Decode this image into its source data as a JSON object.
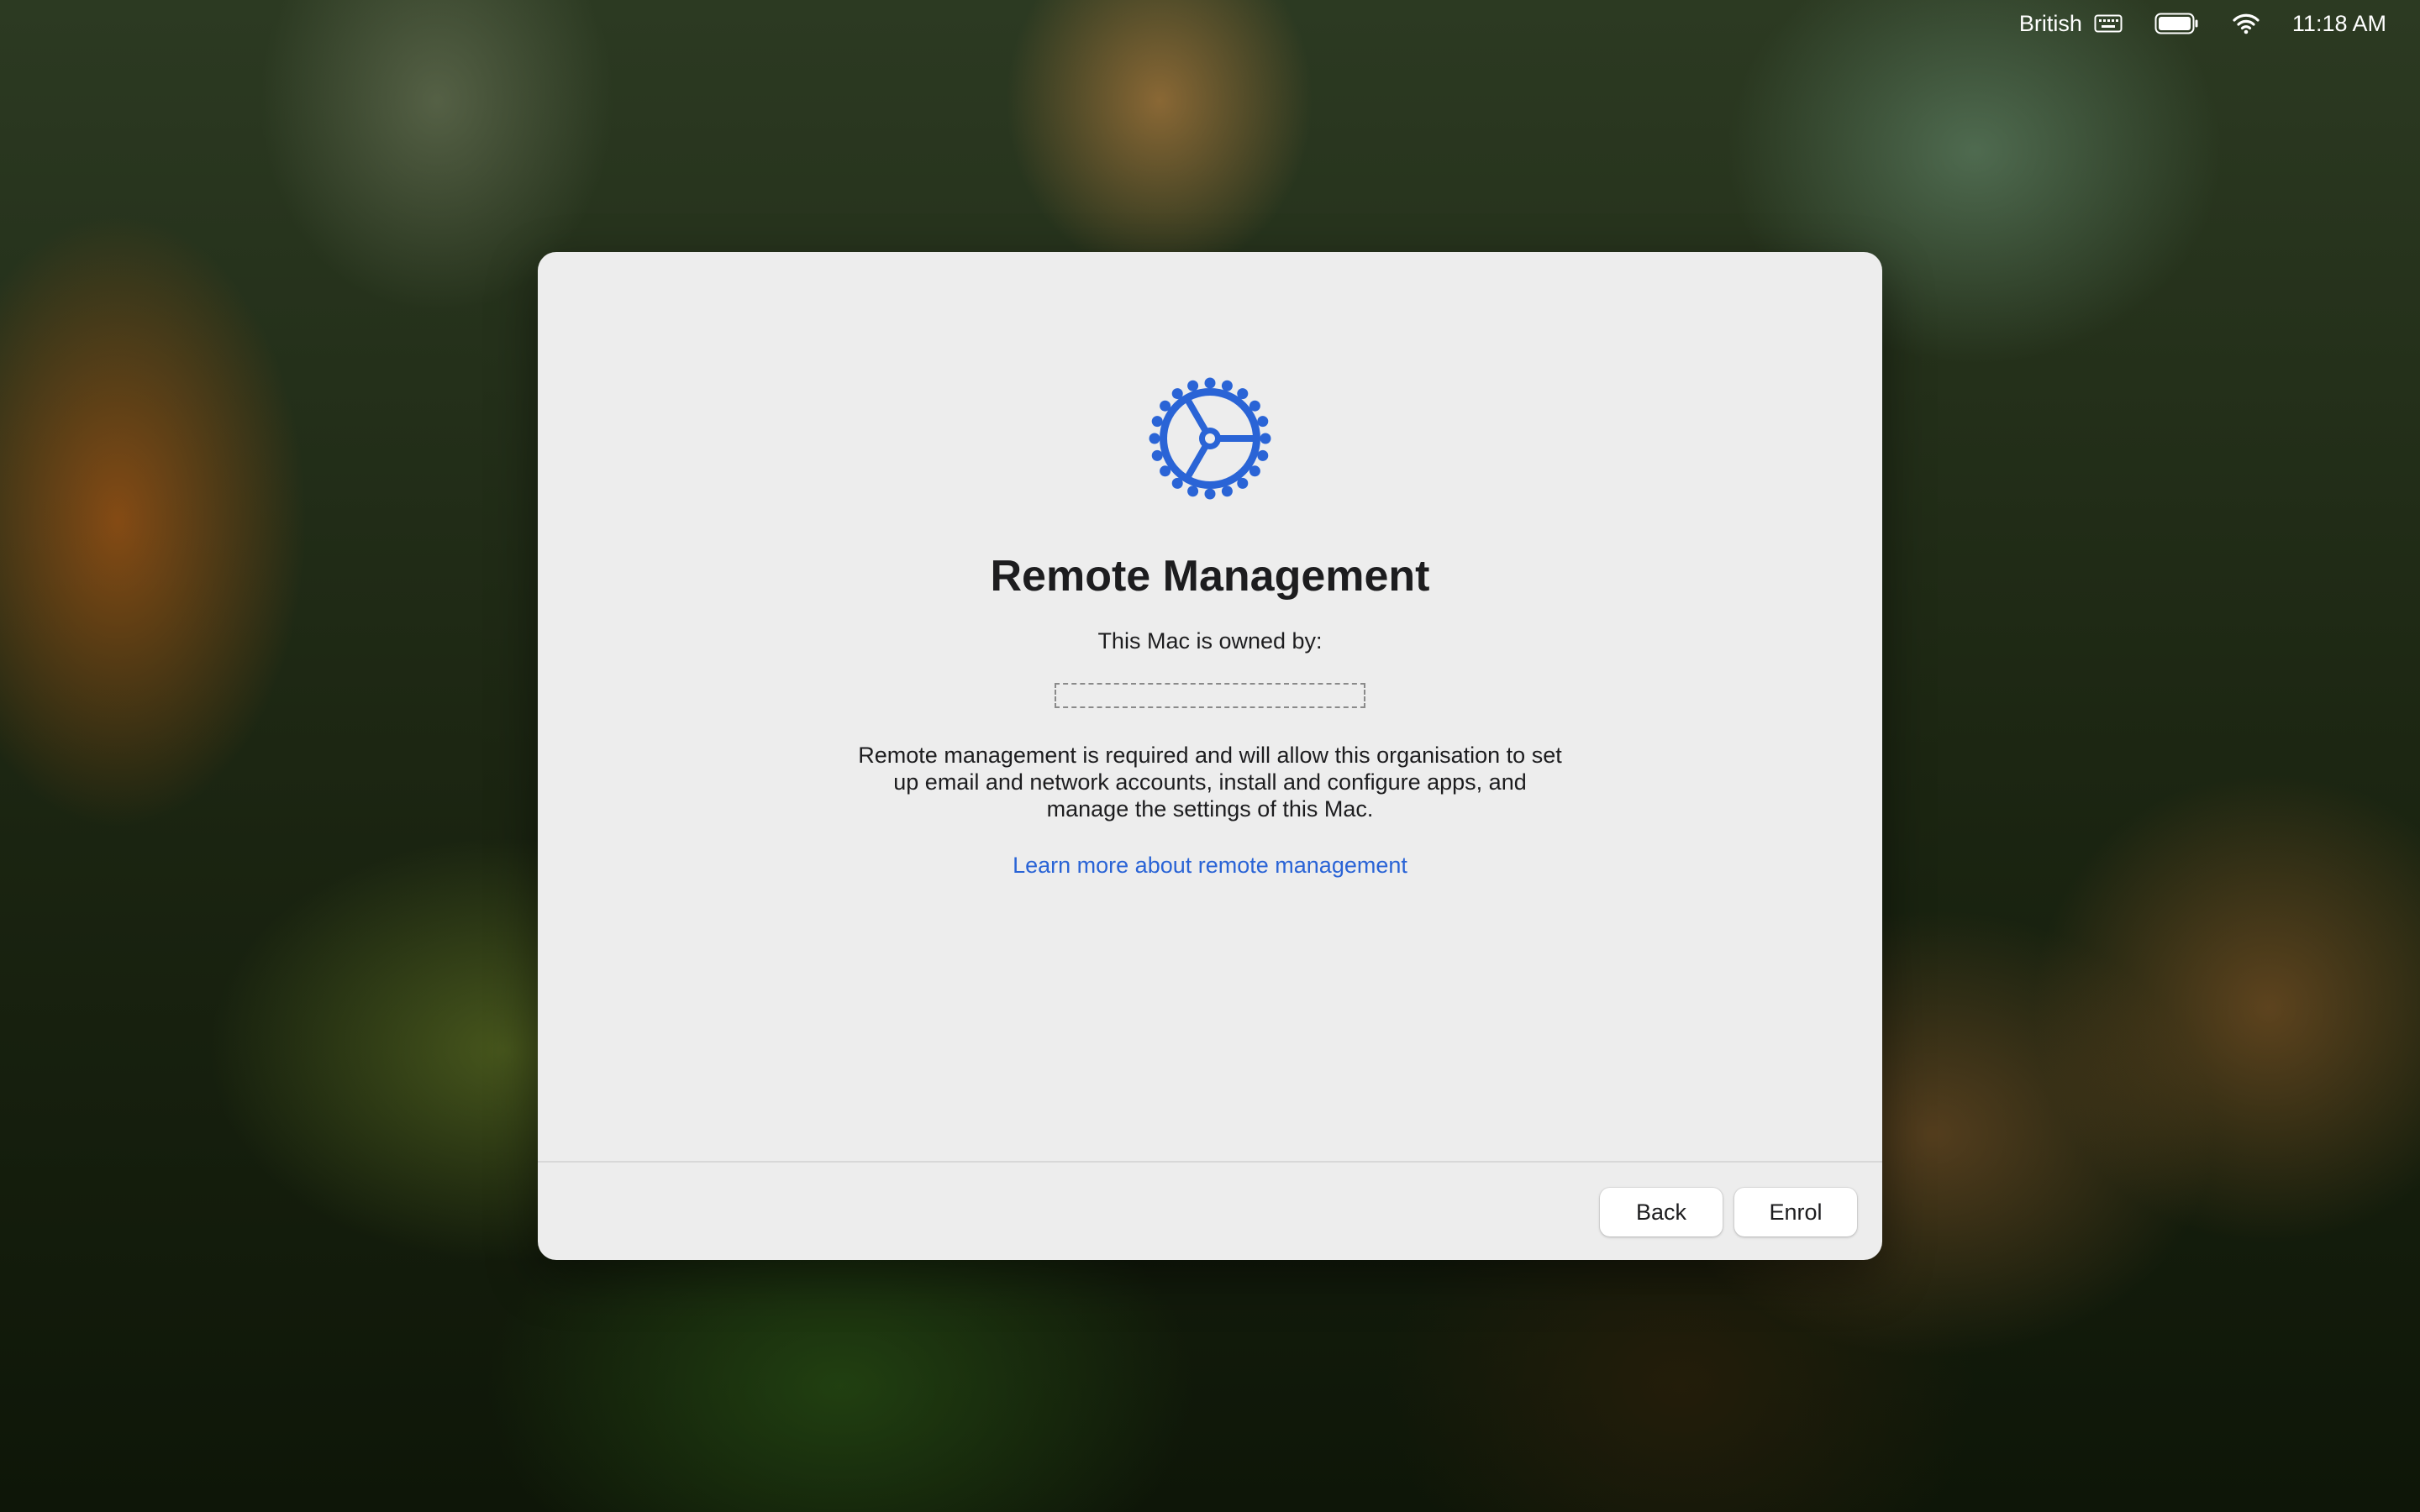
{
  "menubar": {
    "input_source": "British",
    "time": "11:18 AM",
    "icons": [
      "keyboard-icon",
      "battery-icon",
      "wifi-icon"
    ]
  },
  "dialog": {
    "icon": "gear-icon",
    "accent_color": "#2a64d6",
    "title": "Remote Management",
    "owned_label": "This Mac is owned by:",
    "owner_value": "",
    "description": "Remote management is required and will allow this organisation to set up email and network accounts, install and configure apps, and manage the settings of this Mac.",
    "learn_link": "Learn more about remote management",
    "buttons": {
      "back": "Back",
      "enrol": "Enrol"
    }
  }
}
